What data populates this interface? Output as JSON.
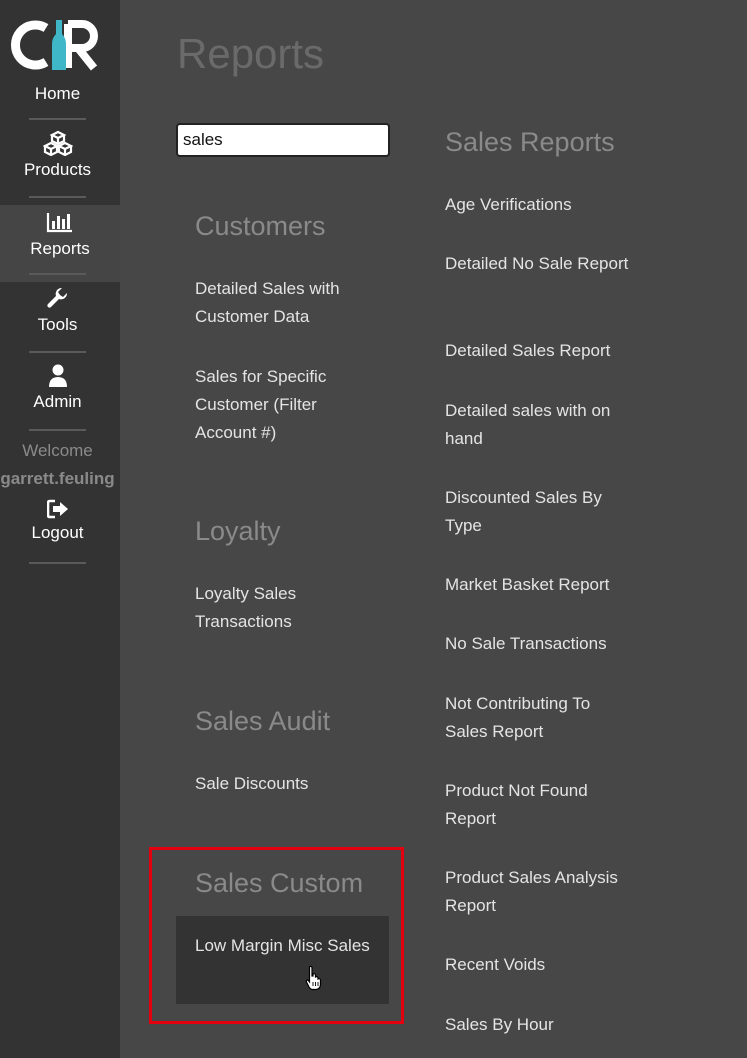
{
  "sidebar": {
    "logo_text": "CR",
    "items": [
      {
        "label": "Home",
        "icon": "home-logo"
      },
      {
        "label": "Products",
        "icon": "cubes-icon"
      },
      {
        "label": "Reports",
        "icon": "bar-chart-icon",
        "active": true
      },
      {
        "label": "Tools",
        "icon": "wrench-icon"
      },
      {
        "label": "Admin",
        "icon": "user-icon"
      }
    ],
    "welcome": "Welcome",
    "username": "garrett.feuling",
    "logout": {
      "label": "Logout",
      "icon": "sign-out-icon"
    }
  },
  "main": {
    "title": "Reports",
    "search": {
      "value": "sales",
      "placeholder": ""
    },
    "left_sections": [
      {
        "title": "Customers",
        "links": [
          "Detailed Sales with Customer Data",
          "Sales for Specific Customer (Filter Account #)"
        ]
      },
      {
        "title": "Loyalty",
        "links": [
          "Loyalty Sales Transactions"
        ]
      },
      {
        "title": "Sales Audit",
        "links": [
          "Sale Discounts"
        ]
      },
      {
        "title": "Sales Custom",
        "links": [
          "Low Margin Misc Sales"
        ]
      }
    ],
    "right_section": {
      "title": "Sales Reports",
      "links": [
        "Age Verifications",
        "Detailed No Sale Report",
        "Detailed Sales Report",
        "Detailed sales with on hand",
        "Discounted Sales By Type",
        "Market Basket Report",
        "No Sale Transactions",
        "Not Contributing To Sales Report",
        "Product Not Found Report",
        "Product Sales Analysis Report",
        "Recent Voids",
        "Sales By Hour"
      ]
    }
  },
  "colors": {
    "sidebar_bg": "#333333",
    "main_bg": "#474747",
    "highlight": "#e3000f",
    "logo_accent": "#3fb7c9"
  }
}
